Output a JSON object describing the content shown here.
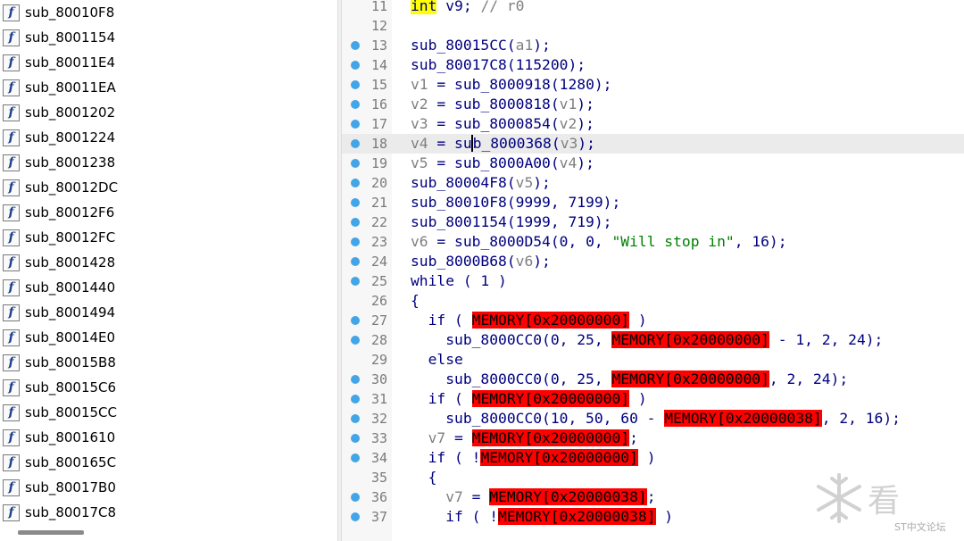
{
  "functions": [
    "sub_80010F8",
    "sub_8001154",
    "sub_80011E4",
    "sub_80011EA",
    "sub_8001202",
    "sub_8001224",
    "sub_8001238",
    "sub_80012DC",
    "sub_80012F6",
    "sub_80012FC",
    "sub_8001428",
    "sub_8001440",
    "sub_8001494",
    "sub_80014E0",
    "sub_80015B8",
    "sub_80015C6",
    "sub_80015CC",
    "sub_8001610",
    "sub_800165C",
    "sub_80017B0",
    "sub_80017C8"
  ],
  "function_icon_glyph": "f",
  "code": {
    "current_line": 18,
    "lines": [
      {
        "n": 11,
        "bp": false,
        "indent": 0,
        "tokens": [
          [
            "hl",
            "int"
          ],
          [
            "pun",
            " v9; "
          ],
          [
            "cmt",
            "// r0"
          ]
        ]
      },
      {
        "n": 12,
        "bp": false,
        "indent": 0,
        "tokens": []
      },
      {
        "n": 13,
        "bp": true,
        "indent": 0,
        "tokens": [
          [
            "fn",
            "sub_80015CC"
          ],
          [
            "pun",
            "("
          ],
          [
            "var",
            "a1"
          ],
          [
            "pun",
            ");"
          ]
        ]
      },
      {
        "n": 14,
        "bp": true,
        "indent": 0,
        "tokens": [
          [
            "fn",
            "sub_80017C8"
          ],
          [
            "pun",
            "(115200);"
          ]
        ]
      },
      {
        "n": 15,
        "bp": true,
        "indent": 0,
        "tokens": [
          [
            "var",
            "v1"
          ],
          [
            "pun",
            " = "
          ],
          [
            "fn",
            "sub_8000918"
          ],
          [
            "pun",
            "(1280);"
          ]
        ]
      },
      {
        "n": 16,
        "bp": true,
        "indent": 0,
        "tokens": [
          [
            "var",
            "v2"
          ],
          [
            "pun",
            " = "
          ],
          [
            "fn",
            "sub_8000818"
          ],
          [
            "pun",
            "("
          ],
          [
            "var",
            "v1"
          ],
          [
            "pun",
            ");"
          ]
        ]
      },
      {
        "n": 17,
        "bp": true,
        "indent": 0,
        "tokens": [
          [
            "var",
            "v3"
          ],
          [
            "pun",
            " = "
          ],
          [
            "fn",
            "sub_8000854"
          ],
          [
            "pun",
            "("
          ],
          [
            "var",
            "v2"
          ],
          [
            "pun",
            ");"
          ]
        ]
      },
      {
        "n": 18,
        "bp": true,
        "indent": 0,
        "tokens": [
          [
            "var",
            "v4"
          ],
          [
            "pun",
            " = "
          ],
          [
            "fn",
            "su"
          ],
          [
            "caret",
            "b_8000368"
          ],
          [
            "pun",
            "("
          ],
          [
            "var",
            "v3"
          ],
          [
            "pun",
            ");"
          ]
        ]
      },
      {
        "n": 19,
        "bp": true,
        "indent": 0,
        "tokens": [
          [
            "var",
            "v5"
          ],
          [
            "pun",
            " = "
          ],
          [
            "fn",
            "sub_8000A00"
          ],
          [
            "pun",
            "("
          ],
          [
            "var",
            "v4"
          ],
          [
            "pun",
            ");"
          ]
        ]
      },
      {
        "n": 20,
        "bp": true,
        "indent": 0,
        "tokens": [
          [
            "fn",
            "sub_80004F8"
          ],
          [
            "pun",
            "("
          ],
          [
            "var",
            "v5"
          ],
          [
            "pun",
            ");"
          ]
        ]
      },
      {
        "n": 21,
        "bp": true,
        "indent": 0,
        "tokens": [
          [
            "fn",
            "sub_80010F8"
          ],
          [
            "pun",
            "(9999, 7199);"
          ]
        ]
      },
      {
        "n": 22,
        "bp": true,
        "indent": 0,
        "tokens": [
          [
            "fn",
            "sub_8001154"
          ],
          [
            "pun",
            "(1999, 719);"
          ]
        ]
      },
      {
        "n": 23,
        "bp": true,
        "indent": 0,
        "tokens": [
          [
            "var",
            "v6"
          ],
          [
            "pun",
            " = "
          ],
          [
            "fn",
            "sub_8000D54"
          ],
          [
            "pun",
            "(0, 0, "
          ],
          [
            "str",
            "\"Will stop in\""
          ],
          [
            "pun",
            ", 16);"
          ]
        ]
      },
      {
        "n": 24,
        "bp": true,
        "indent": 0,
        "tokens": [
          [
            "fn",
            "sub_8000B68"
          ],
          [
            "pun",
            "("
          ],
          [
            "var",
            "v6"
          ],
          [
            "pun",
            ");"
          ]
        ]
      },
      {
        "n": 25,
        "bp": true,
        "indent": 0,
        "tokens": [
          [
            "kw",
            "while"
          ],
          [
            "pun",
            " ( 1 )"
          ]
        ]
      },
      {
        "n": 26,
        "bp": false,
        "indent": 0,
        "tokens": [
          [
            "pun",
            "{"
          ]
        ]
      },
      {
        "n": 27,
        "bp": true,
        "indent": 1,
        "tokens": [
          [
            "kw",
            "if"
          ],
          [
            "pun",
            " ( "
          ],
          [
            "mem",
            "MEMORY[0x20000000]"
          ],
          [
            "pun",
            " )"
          ]
        ]
      },
      {
        "n": 28,
        "bp": true,
        "indent": 2,
        "tokens": [
          [
            "fn",
            "sub_8000CC0"
          ],
          [
            "pun",
            "(0, 25, "
          ],
          [
            "mem",
            "MEMORY[0x20000000]"
          ],
          [
            "pun",
            " - 1, 2, 24);"
          ]
        ]
      },
      {
        "n": 29,
        "bp": false,
        "indent": 1,
        "tokens": [
          [
            "kw",
            "else"
          ]
        ]
      },
      {
        "n": 30,
        "bp": true,
        "indent": 2,
        "tokens": [
          [
            "fn",
            "sub_8000CC0"
          ],
          [
            "pun",
            "(0, 25, "
          ],
          [
            "mem",
            "MEMORY[0x20000000]"
          ],
          [
            "pun",
            ", 2, 24);"
          ]
        ]
      },
      {
        "n": 31,
        "bp": true,
        "indent": 1,
        "tokens": [
          [
            "kw",
            "if"
          ],
          [
            "pun",
            " ( "
          ],
          [
            "mem",
            "MEMORY[0x20000000]"
          ],
          [
            "pun",
            " )"
          ]
        ]
      },
      {
        "n": 32,
        "bp": true,
        "indent": 2,
        "tokens": [
          [
            "fn",
            "sub_8000CC0"
          ],
          [
            "pun",
            "(10, 50, 60 - "
          ],
          [
            "mem",
            "MEMORY[0x20000038]"
          ],
          [
            "pun",
            ", 2, 16);"
          ]
        ]
      },
      {
        "n": 33,
        "bp": true,
        "indent": 1,
        "tokens": [
          [
            "var",
            "v7"
          ],
          [
            "pun",
            " = "
          ],
          [
            "mem",
            "MEMORY[0x20000000]"
          ],
          [
            "pun",
            ";"
          ]
        ]
      },
      {
        "n": 34,
        "bp": true,
        "indent": 1,
        "tokens": [
          [
            "kw",
            "if"
          ],
          [
            "pun",
            " ( !"
          ],
          [
            "mem",
            "MEMORY[0x20000000]"
          ],
          [
            "pun",
            " )"
          ]
        ]
      },
      {
        "n": 35,
        "bp": false,
        "indent": 1,
        "tokens": [
          [
            "pun",
            "{"
          ]
        ]
      },
      {
        "n": 36,
        "bp": true,
        "indent": 2,
        "tokens": [
          [
            "var",
            "v7"
          ],
          [
            "pun",
            " = "
          ],
          [
            "mem",
            "MEMORY[0x20000038]"
          ],
          [
            "pun",
            ";"
          ]
        ]
      },
      {
        "n": 37,
        "bp": true,
        "indent": 2,
        "tokens": [
          [
            "kw",
            "if"
          ],
          [
            "pun",
            " ( !"
          ],
          [
            "mem",
            "MEMORY[0x20000038]"
          ],
          [
            "pun",
            " )"
          ]
        ]
      }
    ]
  },
  "watermark": {
    "text": "ST中文论坛"
  },
  "colors": {
    "breakpoint": "#42a5e8",
    "memory_highlight": "#ff0000",
    "keyword_highlight": "#ffff00",
    "string": "#008000",
    "variable": "#808080",
    "code_text": "#000080"
  }
}
